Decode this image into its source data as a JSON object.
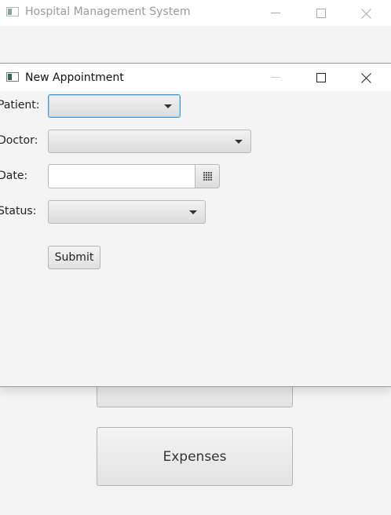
{
  "main_window": {
    "title": "Hospital Management System",
    "buttons": {
      "partial_label": "",
      "expenses_label": "Expenses"
    }
  },
  "dialog": {
    "title": "New Appointment",
    "fields": {
      "patient": {
        "label": "Patient:",
        "value": ""
      },
      "doctor": {
        "label": "Doctor:",
        "value": ""
      },
      "date": {
        "label": "Date:",
        "value": "",
        "placeholder": ""
      },
      "status": {
        "label": "Status:",
        "value": ""
      }
    },
    "submit_label": "Submit"
  },
  "colors": {
    "focus": "#3a9ad9",
    "background": "#f4f4f4"
  },
  "icons": [
    "app-icon",
    "minimize-icon",
    "maximize-icon",
    "close-icon",
    "chevron-down-icon",
    "calendar-icon"
  ]
}
